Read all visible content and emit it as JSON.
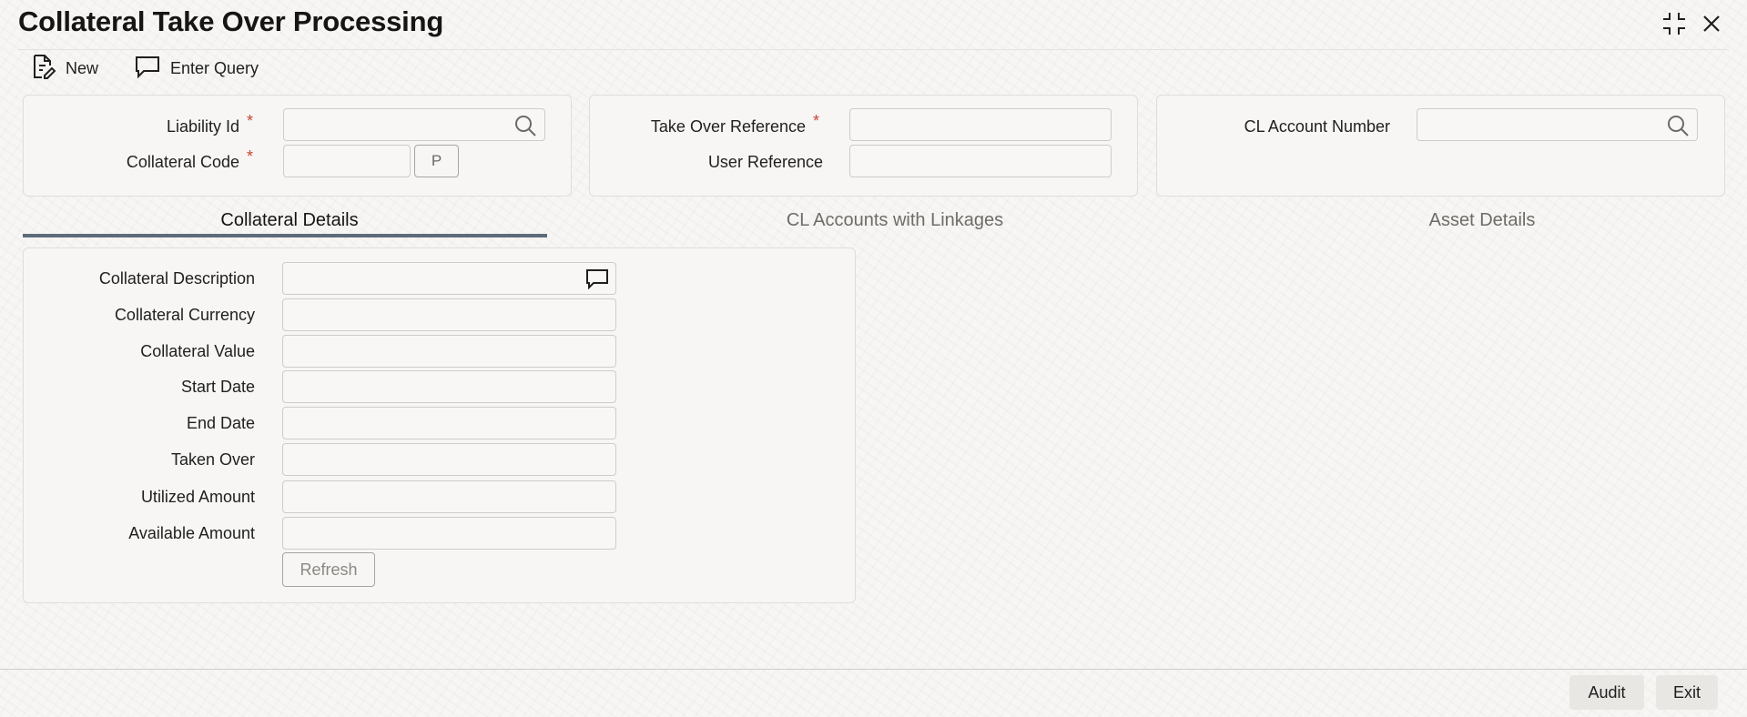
{
  "window": {
    "title": "Collateral Take Over Processing",
    "controls": [
      "minimize-icon",
      "close-icon"
    ]
  },
  "toolbar": {
    "new_label": "New",
    "new_icon": "new-document-icon",
    "enter_query_label": "Enter Query",
    "enter_query_icon": "chat-bubble-icon"
  },
  "header": {
    "liability_id": {
      "label": "Liability Id",
      "value": "",
      "required": true
    },
    "collateral_code": {
      "label": "Collateral Code",
      "value": "",
      "required": true,
      "p_button": "P"
    },
    "take_over_reference": {
      "label": "Take Over Reference",
      "value": "",
      "required": true
    },
    "user_reference": {
      "label": "User Reference",
      "value": ""
    },
    "cl_account_number": {
      "label": "CL Account Number",
      "value": ""
    },
    "required_marker": "*"
  },
  "tabs": [
    {
      "label": "Collateral Details",
      "active": true
    },
    {
      "label": "CL Accounts with Linkages",
      "active": false
    },
    {
      "label": "Asset Details",
      "active": false
    }
  ],
  "collateral_details": {
    "fields": [
      {
        "label": "Collateral Description",
        "value": ""
      },
      {
        "label": "Collateral Currency",
        "value": ""
      },
      {
        "label": "Collateral Value",
        "value": ""
      },
      {
        "label": "Start Date",
        "value": ""
      },
      {
        "label": "End Date",
        "value": ""
      },
      {
        "label": "Taken Over",
        "value": ""
      },
      {
        "label": "Utilized Amount",
        "value": ""
      },
      {
        "label": "Available Amount",
        "value": ""
      }
    ],
    "refresh_label": "Refresh"
  },
  "footer": {
    "audit_label": "Audit",
    "exit_label": "Exit"
  },
  "colors": {
    "required": "#c74634",
    "tab_underline": "#5d6b7a",
    "background": "#f7f6f4"
  }
}
